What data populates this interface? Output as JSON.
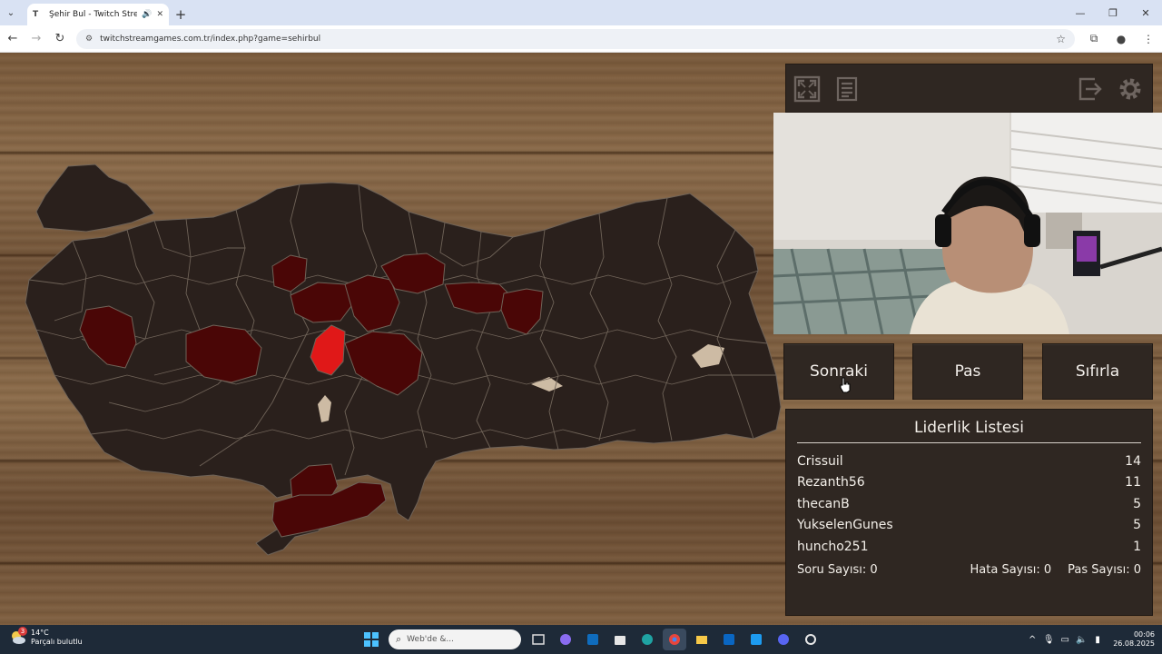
{
  "browser": {
    "tab_title": "Şehir Bul - Twitch Stream G",
    "url": "twitchstreamgames.com.tr/index.php?game=sehirbul"
  },
  "controls": {
    "next_label": "Sonraki",
    "pass_label": "Pas",
    "reset_label": "Sıfırla"
  },
  "leaderboard": {
    "title": "Liderlik Listesi",
    "entries": [
      {
        "name": "Crissuil",
        "score": "14"
      },
      {
        "name": "Rezanth56",
        "score": "11"
      },
      {
        "name": "thecanB",
        "score": "5"
      },
      {
        "name": "YukselenGunes",
        "score": "5"
      },
      {
        "name": "huncho251",
        "score": "1"
      }
    ],
    "question_count": "Soru Sayısı: 0",
    "error_count": "Hata Sayısı: 0",
    "pass_count": "Pas Sayısı: 0"
  },
  "taskbar": {
    "weather_temp": "14°C",
    "weather_desc": "Parçalı bulutlu",
    "weather_badge": "3",
    "search_placeholder": "Web'de &...",
    "time": "00:06",
    "date": "26.08.2025"
  },
  "colors": {
    "panel": "#2f2722",
    "map_base": "#2a201c",
    "region_dark": "#4a0606",
    "region_highlight": "#e01818"
  }
}
